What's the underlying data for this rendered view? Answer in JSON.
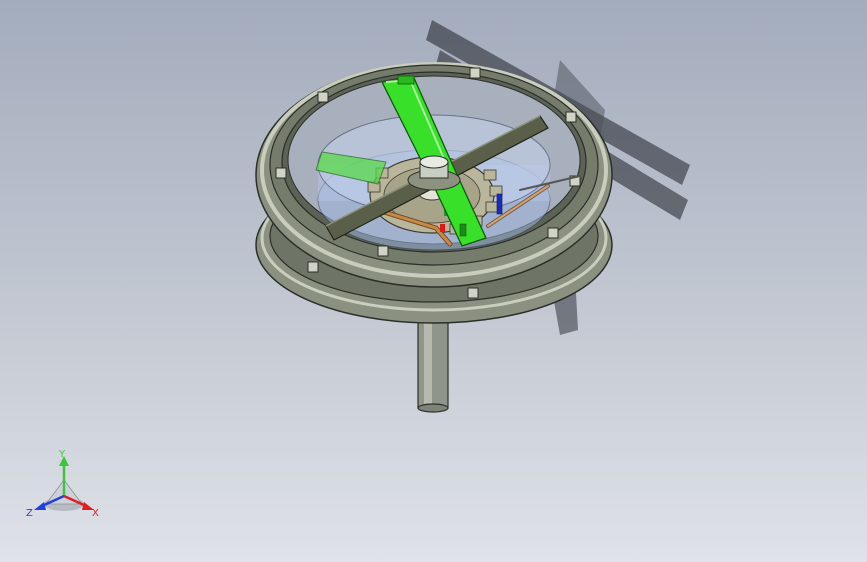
{
  "viewport": {
    "background_top": "#a3acbd",
    "background_bottom": "#dfe2e8"
  },
  "model": {
    "ring_color": "#8a9180",
    "ring_edge_color": "#2b2f2a",
    "arm_color": "#39e02a",
    "bar_color": "#5a5f49",
    "gear_color": "#b9b69b",
    "disc_color": "#9eb4dd",
    "shaft_color": "#8f9589",
    "link_color": "#b07a40",
    "pin_blue": "#1c2db8",
    "pin_red": "#e01818"
  },
  "triad": {
    "y_label": "Y",
    "x_label": "X",
    "z_label": "Z",
    "y_color": "#3fc43f",
    "x_color": "#e02020",
    "z_color": "#2040e0"
  }
}
